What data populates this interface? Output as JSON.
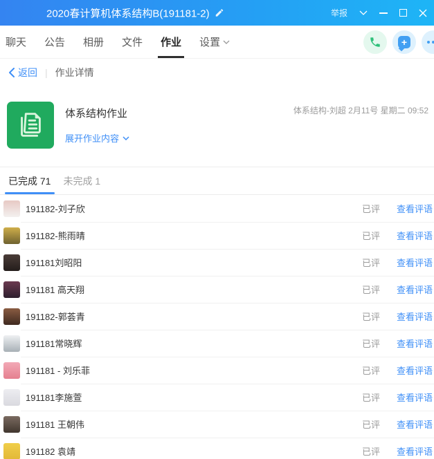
{
  "window": {
    "title": "2020春计算机体系结构B(191181-2)",
    "report_label": "举报"
  },
  "nav": {
    "tabs": [
      {
        "label": "聊天",
        "active": false,
        "has_dropdown": false
      },
      {
        "label": "公告",
        "active": false,
        "has_dropdown": false
      },
      {
        "label": "相册",
        "active": false,
        "has_dropdown": false
      },
      {
        "label": "文件",
        "active": false,
        "has_dropdown": false
      },
      {
        "label": "作业",
        "active": true,
        "has_dropdown": false
      },
      {
        "label": "设置",
        "active": false,
        "has_dropdown": true
      }
    ]
  },
  "breadcrumb": {
    "back_label": "返回",
    "page_title": "作业详情"
  },
  "homework": {
    "title": "体系结构作业",
    "expand_label": "展开作业内容",
    "meta": "体系结构-刘超 2月11号 星期二 09:52"
  },
  "filter_tabs": [
    {
      "label": "已完成 71",
      "active": true
    },
    {
      "label": "未完成 1",
      "active": false
    }
  ],
  "list": {
    "status_label": "已评",
    "action_label": "查看评语",
    "students": [
      {
        "name": "191182-刘子欣",
        "avatar_colors": [
          "#e7c9c4",
          "#f3f0ef"
        ]
      },
      {
        "name": "191182-熊雨晴",
        "avatar_colors": [
          "#cfae4a",
          "#6f6230"
        ]
      },
      {
        "name": "191181刘昭阳",
        "avatar_colors": [
          "#4a3c38",
          "#241d1b"
        ]
      },
      {
        "name": "191181 高天翔",
        "avatar_colors": [
          "#6b3a50",
          "#2e1f2e"
        ]
      },
      {
        "name": "191182-郭荟青",
        "avatar_colors": [
          "#8a5c42",
          "#3f2a20"
        ]
      },
      {
        "name": "191181常晓辉",
        "avatar_colors": [
          "#eef0f2",
          "#a8b0b6"
        ]
      },
      {
        "name": "191181 - 刘乐菲",
        "avatar_colors": [
          "#f2a9b6",
          "#e5808f"
        ]
      },
      {
        "name": "191181李施萱",
        "avatar_colors": [
          "#ededf1",
          "#d9d9df"
        ]
      },
      {
        "name": "191181 王朝伟",
        "avatar_colors": [
          "#7a6a60",
          "#41372f"
        ]
      },
      {
        "name": "191182 袁靖",
        "avatar_colors": [
          "#f0ce4a",
          "#e2b838"
        ]
      }
    ]
  },
  "colors": {
    "accent_blue": "#3f8ff7",
    "titlebar_gradient_start": "#3484f1",
    "titlebar_gradient_end": "#1eb5f6",
    "green_icon_bg": "#20aa5e",
    "phone_green": "#2ec07a"
  }
}
